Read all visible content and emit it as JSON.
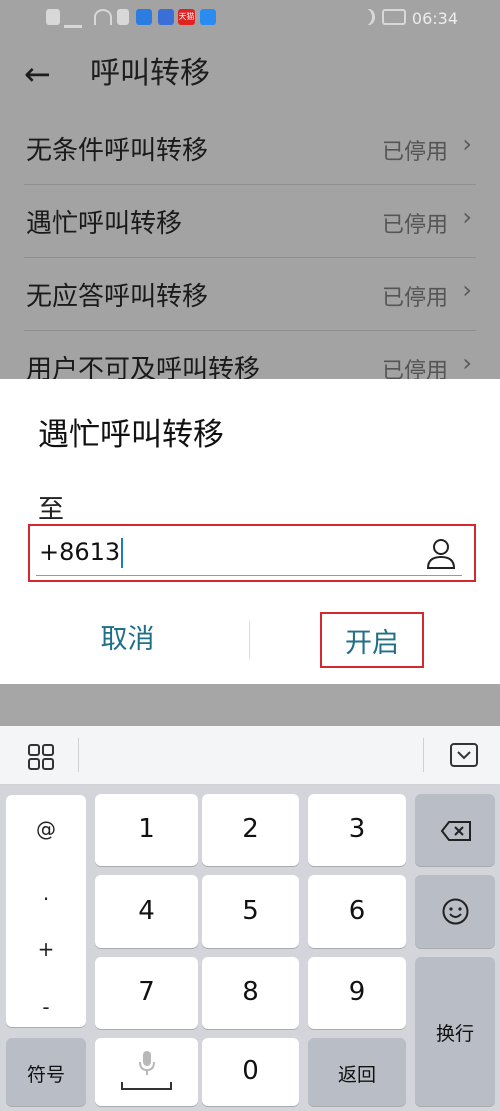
{
  "title": "呼叫转移",
  "status_bar": {
    "time": "06:34",
    "app_badge": "天猫"
  },
  "settings": [
    {
      "label": "无条件呼叫转移",
      "status": "已停用"
    },
    {
      "label": "遇忙呼叫转移",
      "status": "已停用"
    },
    {
      "label": "无应答呼叫转移",
      "status": "已停用"
    },
    {
      "label": "用户不可及呼叫转移",
      "status": "已停用"
    }
  ],
  "dialog": {
    "title": "遇忙呼叫转移",
    "to_label": "至",
    "phone_value": "+8613",
    "cancel_label": "取消",
    "confirm_label": "开启"
  },
  "keyboard": {
    "symbols": [
      "@",
      ".",
      "+",
      "-"
    ],
    "digits": [
      "1",
      "2",
      "3",
      "4",
      "5",
      "6",
      "7",
      "8",
      "9",
      "0"
    ],
    "symbol_key": "符号",
    "return_key": "返回",
    "newline_key": "换行"
  },
  "colors": {
    "accent": "#1f6f87",
    "highlight_box": "#d3292e",
    "caret": "#1a7fc1"
  }
}
